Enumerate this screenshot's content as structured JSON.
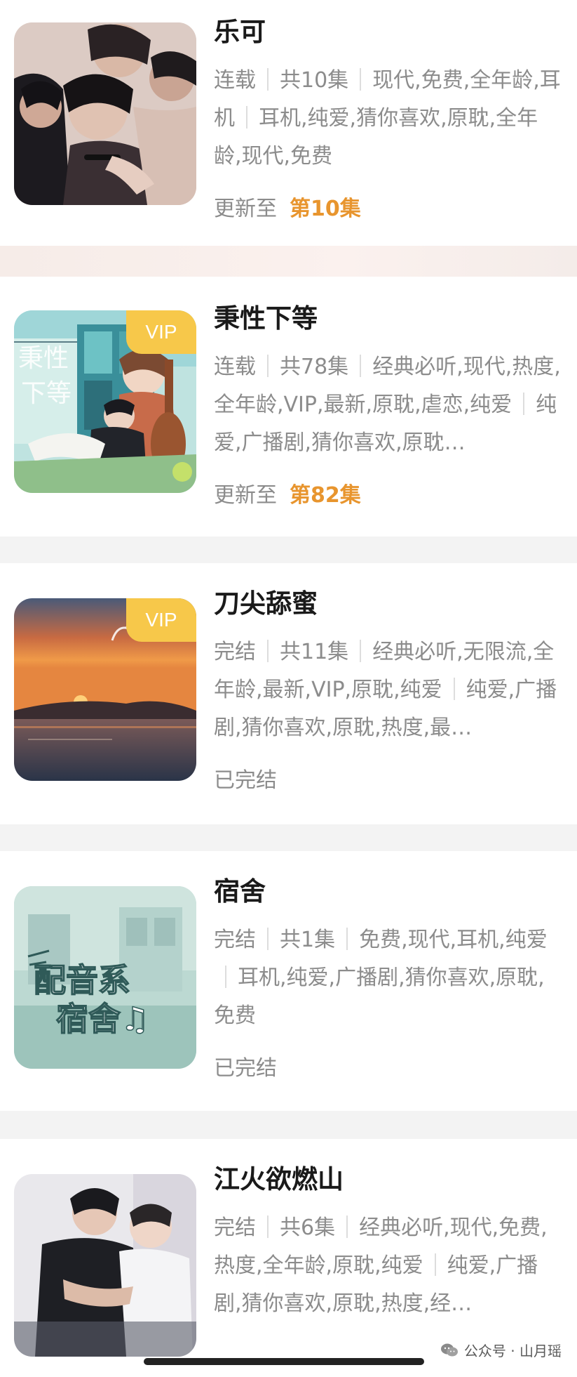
{
  "items": [
    {
      "title": "乐可",
      "tag_segments": [
        "连载",
        "共10集",
        "现代,免费,全年龄,耳机",
        "耳机,纯爱,猜你喜欢,原耽,全年龄,现代,免费"
      ],
      "status_text": "更新至",
      "episode_text": "第10集",
      "vip": false
    },
    {
      "title": "秉性下等",
      "tag_segments": [
        "连载",
        "共78集",
        "经典必听,现代,热度,全年龄,VIP,最新,原耽,虐恋,纯爱",
        "纯爱,广播剧,猜你喜欢,原耽…"
      ],
      "status_text": "更新至",
      "episode_text": "第82集",
      "vip": true,
      "vip_label": "VIP",
      "cover_text": "秉性下等"
    },
    {
      "title": "刀尖舔蜜",
      "tag_segments": [
        "完结",
        "共11集",
        "经典必听,无限流,全年龄,最新,VIP,原耽,纯爱",
        "纯爱,广播剧,猜你喜欢,原耽,热度,最…"
      ],
      "status_text": "已完结",
      "episode_text": "",
      "vip": true,
      "vip_label": "VIP"
    },
    {
      "title": "宿舍",
      "tag_segments": [
        "完结",
        "共1集",
        "免费,现代,耳机,纯爱",
        "耳机,纯爱,广播剧,猜你喜欢,原耽,免费"
      ],
      "status_text": "已完结",
      "episode_text": "",
      "vip": false,
      "cover_text": "配音系宿舍"
    },
    {
      "title": "江火欲燃山",
      "tag_segments": [
        "完结",
        "共6集",
        "经典必听,现代,免费,热度,全年龄,原耽,纯爱",
        "纯爱,广播剧,猜你喜欢,原耽,热度,经…"
      ],
      "status_text": "",
      "episode_text": "",
      "vip": false
    }
  ],
  "watermark": {
    "text": "公众号 · 山月瑶",
    "icon": "wechat-icon"
  },
  "colors": {
    "vip_badge": "#f7c84a",
    "episode_highlight": "#e8952e",
    "tag_text": "#8c8c8c"
  }
}
